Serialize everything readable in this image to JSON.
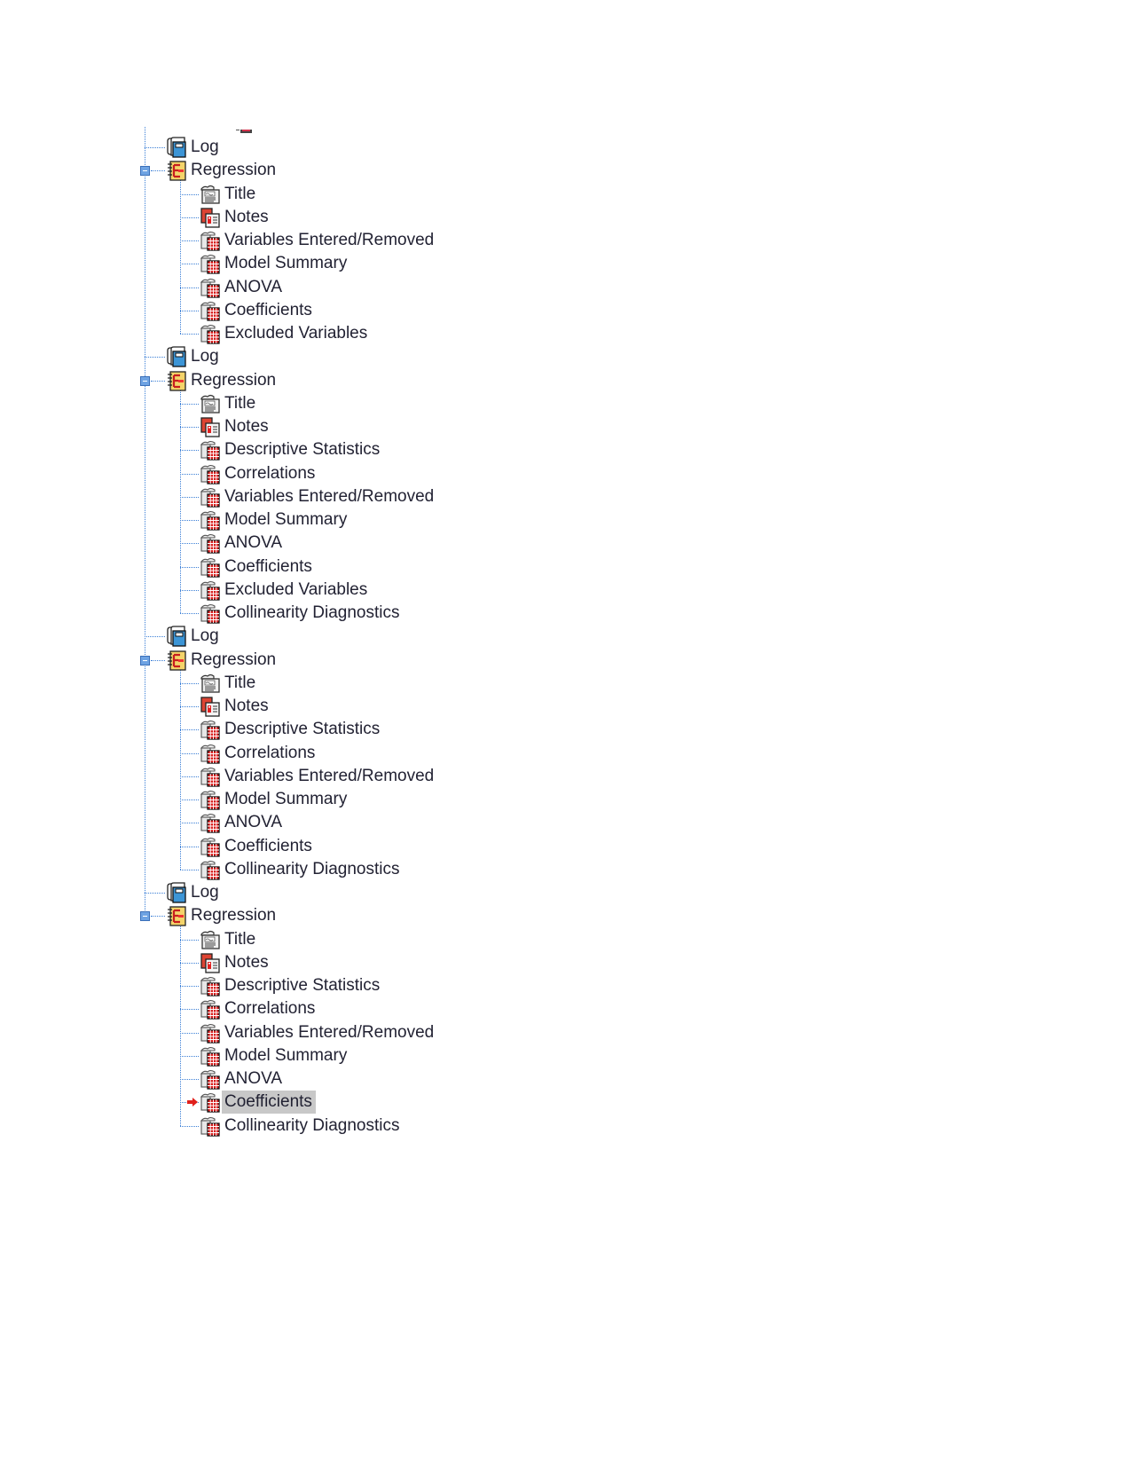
{
  "tree": {
    "nodes": [
      {
        "level": 1,
        "type": "log",
        "icon": "log-icon",
        "label": "Log"
      },
      {
        "level": 1,
        "type": "regression",
        "icon": "regression-icon",
        "label": "Regression",
        "expanded": true
      },
      {
        "level": 2,
        "type": "title",
        "icon": "title-icon",
        "label": "Title"
      },
      {
        "level": 2,
        "type": "notes",
        "icon": "notes-icon",
        "label": "Notes"
      },
      {
        "level": 2,
        "type": "table",
        "icon": "table-icon",
        "label": "Variables Entered/Removed"
      },
      {
        "level": 2,
        "type": "table",
        "icon": "table-icon",
        "label": "Model Summary"
      },
      {
        "level": 2,
        "type": "table",
        "icon": "table-icon",
        "label": "ANOVA"
      },
      {
        "level": 2,
        "type": "table",
        "icon": "table-icon",
        "label": "Coefficients"
      },
      {
        "level": 2,
        "type": "table",
        "icon": "table-icon",
        "label": "Excluded Variables",
        "last": true
      },
      {
        "level": 1,
        "type": "log",
        "icon": "log-icon",
        "label": "Log"
      },
      {
        "level": 1,
        "type": "regression",
        "icon": "regression-icon",
        "label": "Regression",
        "expanded": true
      },
      {
        "level": 2,
        "type": "title",
        "icon": "title-icon",
        "label": "Title"
      },
      {
        "level": 2,
        "type": "notes",
        "icon": "notes-icon",
        "label": "Notes"
      },
      {
        "level": 2,
        "type": "table",
        "icon": "table-icon",
        "label": "Descriptive Statistics"
      },
      {
        "level": 2,
        "type": "table",
        "icon": "table-icon",
        "label": "Correlations"
      },
      {
        "level": 2,
        "type": "table",
        "icon": "table-icon",
        "label": "Variables Entered/Removed"
      },
      {
        "level": 2,
        "type": "table",
        "icon": "table-icon",
        "label": "Model Summary"
      },
      {
        "level": 2,
        "type": "table",
        "icon": "table-icon",
        "label": "ANOVA"
      },
      {
        "level": 2,
        "type": "table",
        "icon": "table-icon",
        "label": "Coefficients"
      },
      {
        "level": 2,
        "type": "table",
        "icon": "table-icon",
        "label": "Excluded Variables"
      },
      {
        "level": 2,
        "type": "table",
        "icon": "table-icon",
        "label": "Collinearity Diagnostics",
        "last": true
      },
      {
        "level": 1,
        "type": "log",
        "icon": "log-icon",
        "label": "Log"
      },
      {
        "level": 1,
        "type": "regression",
        "icon": "regression-icon",
        "label": "Regression",
        "expanded": true
      },
      {
        "level": 2,
        "type": "title",
        "icon": "title-icon",
        "label": "Title"
      },
      {
        "level": 2,
        "type": "notes",
        "icon": "notes-icon",
        "label": "Notes"
      },
      {
        "level": 2,
        "type": "table",
        "icon": "table-icon",
        "label": "Descriptive Statistics"
      },
      {
        "level": 2,
        "type": "table",
        "icon": "table-icon",
        "label": "Correlations"
      },
      {
        "level": 2,
        "type": "table",
        "icon": "table-icon",
        "label": "Variables Entered/Removed"
      },
      {
        "level": 2,
        "type": "table",
        "icon": "table-icon",
        "label": "Model Summary"
      },
      {
        "level": 2,
        "type": "table",
        "icon": "table-icon",
        "label": "ANOVA"
      },
      {
        "level": 2,
        "type": "table",
        "icon": "table-icon",
        "label": "Coefficients"
      },
      {
        "level": 2,
        "type": "table",
        "icon": "table-icon",
        "label": "Collinearity Diagnostics",
        "last": true
      },
      {
        "level": 1,
        "type": "log",
        "icon": "log-icon",
        "label": "Log"
      },
      {
        "level": 1,
        "type": "regression",
        "icon": "regression-icon",
        "label": "Regression",
        "expanded": true,
        "lastTop": true
      },
      {
        "level": 2,
        "type": "title",
        "icon": "title-icon",
        "label": "Title"
      },
      {
        "level": 2,
        "type": "notes",
        "icon": "notes-icon",
        "label": "Notes"
      },
      {
        "level": 2,
        "type": "table",
        "icon": "table-icon",
        "label": "Descriptive Statistics"
      },
      {
        "level": 2,
        "type": "table",
        "icon": "table-icon",
        "label": "Correlations"
      },
      {
        "level": 2,
        "type": "table",
        "icon": "table-icon",
        "label": "Variables Entered/Removed"
      },
      {
        "level": 2,
        "type": "table",
        "icon": "table-icon",
        "label": "Model Summary"
      },
      {
        "level": 2,
        "type": "table",
        "icon": "table-icon",
        "label": "ANOVA"
      },
      {
        "level": 2,
        "type": "table",
        "icon": "table-icon",
        "label": "Coefficients",
        "selected": true,
        "current": true
      },
      {
        "level": 2,
        "type": "table",
        "icon": "table-icon",
        "label": "Collinearity Diagnostics",
        "last": true
      }
    ]
  },
  "colors": {
    "tree_line": "#3b7fd6",
    "selection_bg": "#c8c8c8",
    "current_arrow": "#e0201c",
    "text": "#222233"
  }
}
